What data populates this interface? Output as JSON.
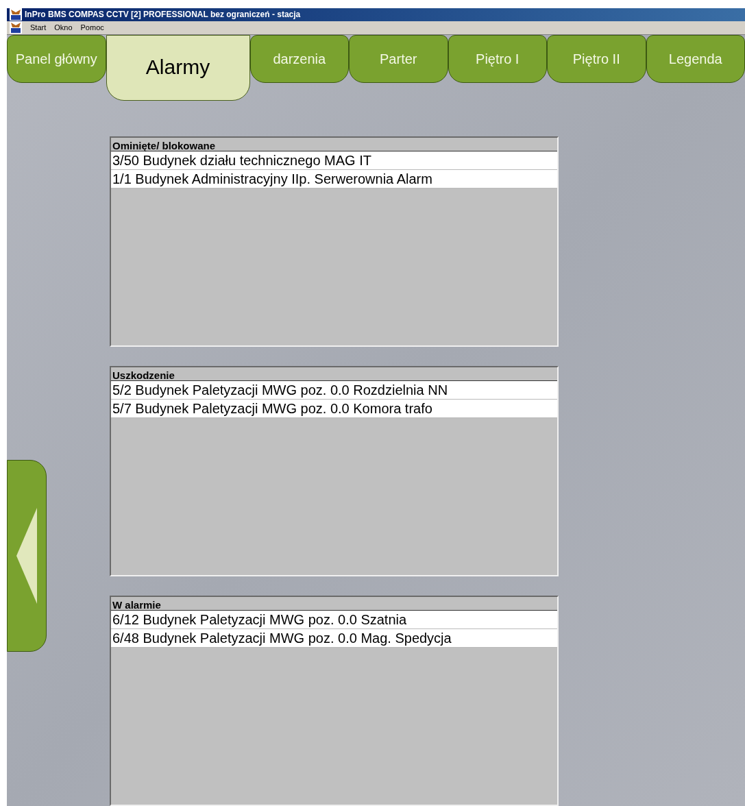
{
  "window": {
    "title": "InPro BMS  COMPAS  CCTV [2] PROFESSIONAL bez ograniczeń  - stacja"
  },
  "menu": [
    "Start",
    "Okno",
    "Pomoc"
  ],
  "tabs": [
    {
      "label": "Panel główny",
      "selected": false
    },
    {
      "label": "Alarmy",
      "selected": true
    },
    {
      "label": "darzenia",
      "selected": false
    },
    {
      "label": "Parter",
      "selected": false
    },
    {
      "label": "Piętro I",
      "selected": false
    },
    {
      "label": "Piętro II",
      "selected": false
    },
    {
      "label": "Legenda",
      "selected": false
    }
  ],
  "lists": [
    {
      "title": "Ominięte/ blokowane",
      "rows": [
        "3/50 Budynek działu technicznego MAG IT",
        "1/1 Budynek Administracyjny IIp. Serwerownia Alarm"
      ]
    },
    {
      "title": "Uszkodzenie",
      "rows": [
        "5/2 Budynek Paletyzacji MWG poz. 0.0 Rozdzielnia NN",
        "5/7 Budynek Paletyzacji MWG poz. 0.0 Komora trafo"
      ]
    },
    {
      "title": "W alarmie",
      "rows": [
        "6/12 Budynek Paletyzacji MWG poz. 0.0 Szatnia",
        "6/48 Budynek Paletyzacji MWG poz. 0.0 Mag. Spedycja"
      ]
    }
  ]
}
